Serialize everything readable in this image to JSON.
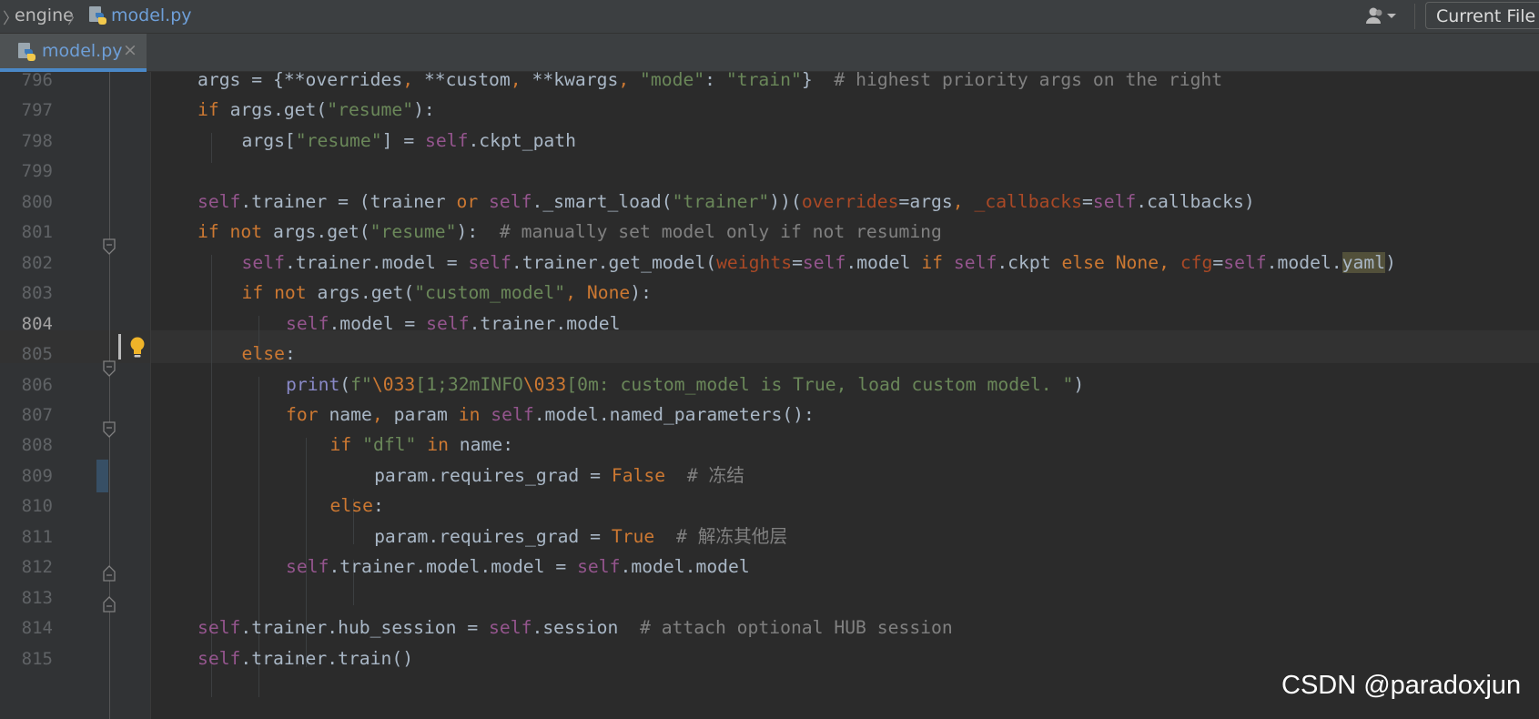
{
  "navbar": {
    "breadcrumb_folder": "engine",
    "breadcrumb_file": "model.py",
    "file_icon": "python-file-icon",
    "user_icon": "user-dropdown-icon",
    "current_file_button": "Current File"
  },
  "tabs": [
    {
      "label": "model.py",
      "icon": "python-file-icon",
      "close_icon": "close-icon",
      "active": true
    }
  ],
  "editor": {
    "current_line": "804",
    "intention_icon": "lightbulb-icon",
    "lines": [
      {
        "num": "796",
        "frags": [
          {
            "t": "args = {**overrides"
          },
          {
            "t": ", ",
            "c": "kw"
          },
          {
            "t": "**custom"
          },
          {
            "t": ", ",
            "c": "kw"
          },
          {
            "t": "**kwargs"
          },
          {
            "t": ", ",
            "c": "kw"
          },
          {
            "t": "\"mode\"",
            "c": "str"
          },
          {
            "t": ": "
          },
          {
            "t": "\"train\"",
            "c": "str"
          },
          {
            "t": "}  "
          },
          {
            "t": "# highest priority args on the right",
            "c": "cmt"
          }
        ]
      },
      {
        "num": "797",
        "frags": [
          {
            "t": "if ",
            "c": "kw"
          },
          {
            "t": "args.get("
          },
          {
            "t": "\"resume\"",
            "c": "str"
          },
          {
            "t": "):"
          }
        ]
      },
      {
        "num": "798",
        "frags": [
          {
            "t": "args["
          },
          {
            "t": "\"resume\"",
            "c": "str"
          },
          {
            "t": "] = "
          },
          {
            "t": "self",
            "c": "slf"
          },
          {
            "t": ".ckpt_path"
          }
        ]
      },
      {
        "num": "799",
        "frags": []
      },
      {
        "num": "800",
        "frags": [
          {
            "t": "self",
            "c": "slf"
          },
          {
            "t": ".trainer = (trainer "
          },
          {
            "t": "or ",
            "c": "kw"
          },
          {
            "t": "self",
            "c": "slf"
          },
          {
            "t": "._smart_load("
          },
          {
            "t": "\"trainer\"",
            "c": "str"
          },
          {
            "t": "))("
          },
          {
            "t": "overrides",
            "c": "prm"
          },
          {
            "t": "=args"
          },
          {
            "t": ", ",
            "c": "kw"
          },
          {
            "t": "_callbacks",
            "c": "prm"
          },
          {
            "t": "="
          },
          {
            "t": "self",
            "c": "slf"
          },
          {
            "t": ".callbacks)"
          }
        ]
      },
      {
        "num": "801",
        "frags": [
          {
            "t": "if not ",
            "c": "kw"
          },
          {
            "t": "args.get("
          },
          {
            "t": "\"resume\"",
            "c": "str"
          },
          {
            "t": "):  "
          },
          {
            "t": "# manually set model only if not resuming",
            "c": "cmt"
          }
        ]
      },
      {
        "num": "802",
        "frags": [
          {
            "t": "self",
            "c": "slf"
          },
          {
            "t": ".trainer.model = "
          },
          {
            "t": "self",
            "c": "slf"
          },
          {
            "t": ".trainer.get_model("
          },
          {
            "t": "weights",
            "c": "prm"
          },
          {
            "t": "="
          },
          {
            "t": "self",
            "c": "slf"
          },
          {
            "t": ".model "
          },
          {
            "t": "if ",
            "c": "kw"
          },
          {
            "t": "self",
            "c": "slf"
          },
          {
            "t": ".ckpt "
          },
          {
            "t": "else None, ",
            "c": "kw"
          },
          {
            "t": "cfg",
            "c": "prm"
          },
          {
            "t": "="
          },
          {
            "t": "self",
            "c": "slf"
          },
          {
            "t": ".model."
          },
          {
            "t": "yaml",
            "c": "hl"
          },
          {
            "t": ")"
          }
        ]
      },
      {
        "num": "803",
        "frags": [
          {
            "t": "if not ",
            "c": "kw"
          },
          {
            "t": "args.get("
          },
          {
            "t": "\"custom_model\"",
            "c": "str"
          },
          {
            "t": ", ",
            "c": "kw"
          },
          {
            "t": "None",
            "c": "kw"
          },
          {
            "t": "):"
          }
        ]
      },
      {
        "num": "804",
        "frags": [
          {
            "t": "self",
            "c": "slf"
          },
          {
            "t": ".model = "
          },
          {
            "t": "self",
            "c": "slf"
          },
          {
            "t": ".trainer.model"
          }
        ]
      },
      {
        "num": "805",
        "frags": [
          {
            "t": "else",
            "c": "kw"
          },
          {
            "t": ":"
          }
        ]
      },
      {
        "num": "806",
        "frags": [
          {
            "t": "print",
            "c": "bi"
          },
          {
            "t": "("
          },
          {
            "t": "f\"",
            "c": "str"
          },
          {
            "t": "\\033",
            "c": "esc"
          },
          {
            "t": "[1;32mINFO",
            "c": "str"
          },
          {
            "t": "\\033",
            "c": "esc"
          },
          {
            "t": "[0m: custom_model is True, load custom model. \"",
            "c": "str"
          },
          {
            "t": ")"
          }
        ]
      },
      {
        "num": "807",
        "frags": [
          {
            "t": "for ",
            "c": "kw"
          },
          {
            "t": "name"
          },
          {
            "t": ", ",
            "c": "kw"
          },
          {
            "t": "param "
          },
          {
            "t": "in ",
            "c": "kw"
          },
          {
            "t": "self",
            "c": "slf"
          },
          {
            "t": ".model.named_parameters():"
          }
        ]
      },
      {
        "num": "808",
        "frags": [
          {
            "t": "if ",
            "c": "kw"
          },
          {
            "t": "\"dfl\" ",
            "c": "str"
          },
          {
            "t": "in ",
            "c": "kw"
          },
          {
            "t": "name:"
          }
        ]
      },
      {
        "num": "809",
        "frags": [
          {
            "t": "param.requires_grad = "
          },
          {
            "t": "False",
            "c": "kw"
          },
          {
            "t": "  "
          },
          {
            "t": "# 冻结",
            "c": "cmt"
          }
        ]
      },
      {
        "num": "810",
        "frags": [
          {
            "t": "else",
            "c": "kw"
          },
          {
            "t": ":"
          }
        ]
      },
      {
        "num": "811",
        "frags": [
          {
            "t": "param.requires_grad = "
          },
          {
            "t": "True",
            "c": "kw"
          },
          {
            "t": "  "
          },
          {
            "t": "# 解冻其他层",
            "c": "cmt"
          }
        ]
      },
      {
        "num": "812",
        "frags": [
          {
            "t": "self",
            "c": "slf"
          },
          {
            "t": ".trainer.model.model = "
          },
          {
            "t": "self",
            "c": "slf"
          },
          {
            "t": ".model.model"
          }
        ]
      },
      {
        "num": "813",
        "frags": []
      },
      {
        "num": "814",
        "frags": [
          {
            "t": "self",
            "c": "slf"
          },
          {
            "t": ".trainer.hub_session = "
          },
          {
            "t": "self",
            "c": "slf"
          },
          {
            "t": ".session  "
          },
          {
            "t": "# attach optional HUB session",
            "c": "cmt"
          }
        ]
      },
      {
        "num": "815",
        "frags": [
          {
            "t": "self",
            "c": "slf"
          },
          {
            "t": ".trainer.train()"
          }
        ]
      }
    ]
  },
  "watermark": "CSDN @paradoxjun"
}
